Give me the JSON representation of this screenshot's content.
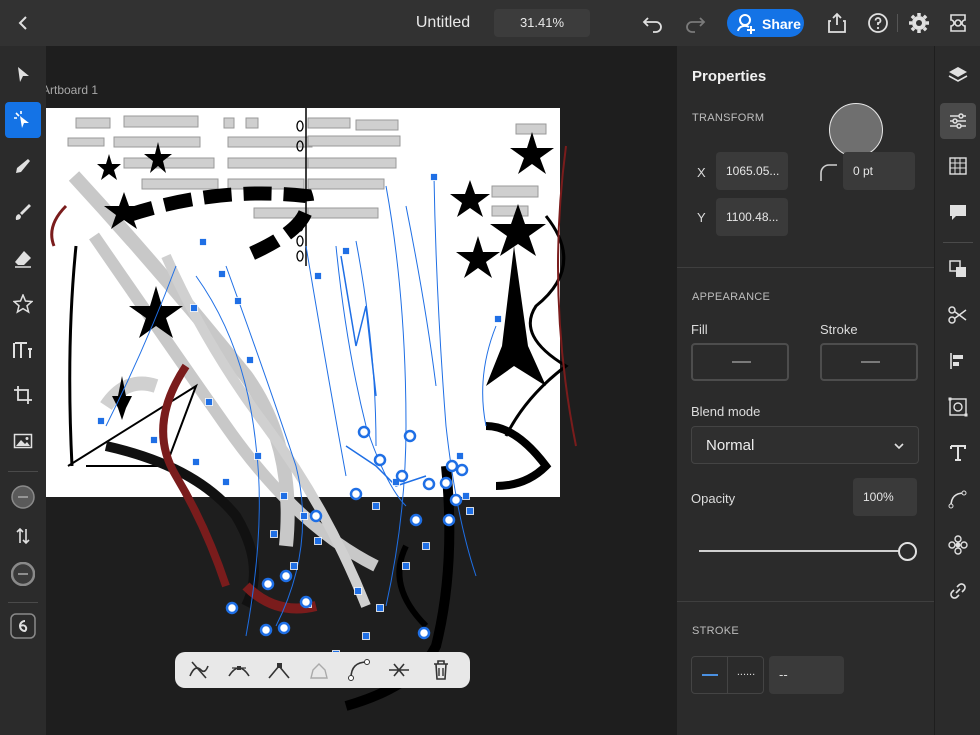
{
  "topbar": {
    "title": "Untitled",
    "zoom": "31.41%",
    "share_label": "Share"
  },
  "canvas": {
    "artboard_label": "Artboard 1"
  },
  "properties": {
    "title": "Properties",
    "transform": {
      "heading": "TRANSFORM",
      "x_label": "X",
      "x_value": "1065.05...",
      "y_label": "Y",
      "y_value": "1100.48...",
      "corner_radius": "0 pt"
    },
    "appearance": {
      "heading": "APPEARANCE",
      "fill_label": "Fill",
      "stroke_label": "Stroke",
      "blend_label": "Blend mode",
      "blend_value": "Normal",
      "opacity_label": "Opacity",
      "opacity_value": "100%",
      "opacity_fraction": 1.0
    },
    "stroke": {
      "heading": "STROKE",
      "dashed_glyph": "......",
      "weight": "--"
    }
  },
  "icons": {
    "left_tools": [
      "selection-icon",
      "direct-selection-icon",
      "pen-icon",
      "brush-icon",
      "eraser-icon",
      "shape-icon",
      "type-icon",
      "crop-icon",
      "image-icon"
    ],
    "right_rail": [
      "layers-icon",
      "properties-icon",
      "grid-icon",
      "comments-icon",
      "arrange-icon",
      "scissors-icon",
      "align-icon",
      "repeat-icon",
      "text-icon",
      "path-icon",
      "pattern-icon",
      "link-icon"
    ]
  },
  "colors": {
    "accent": "#1473e6",
    "panel_bg": "#2b2b2b",
    "canvas_bg": "#1e1e1e",
    "selection": "#1f6fe5"
  }
}
